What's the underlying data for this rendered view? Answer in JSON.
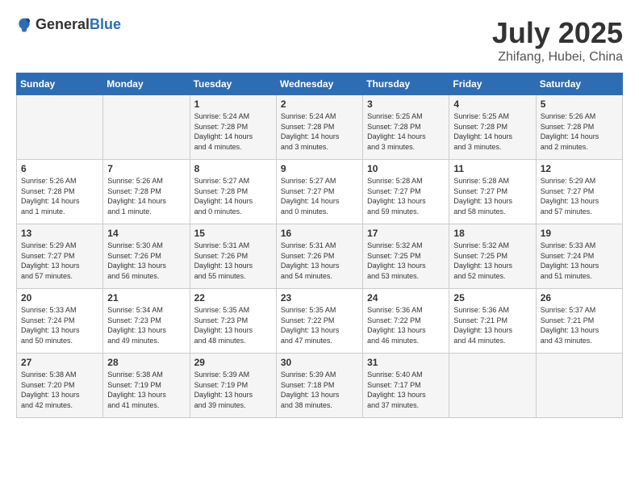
{
  "header": {
    "logo_general": "General",
    "logo_blue": "Blue",
    "month_year": "July 2025",
    "location": "Zhifang, Hubei, China"
  },
  "weekdays": [
    "Sunday",
    "Monday",
    "Tuesday",
    "Wednesday",
    "Thursday",
    "Friday",
    "Saturday"
  ],
  "weeks": [
    [
      {
        "day": "",
        "info": ""
      },
      {
        "day": "",
        "info": ""
      },
      {
        "day": "1",
        "info": "Sunrise: 5:24 AM\nSunset: 7:28 PM\nDaylight: 14 hours\nand 4 minutes."
      },
      {
        "day": "2",
        "info": "Sunrise: 5:24 AM\nSunset: 7:28 PM\nDaylight: 14 hours\nand 3 minutes."
      },
      {
        "day": "3",
        "info": "Sunrise: 5:25 AM\nSunset: 7:28 PM\nDaylight: 14 hours\nand 3 minutes."
      },
      {
        "day": "4",
        "info": "Sunrise: 5:25 AM\nSunset: 7:28 PM\nDaylight: 14 hours\nand 3 minutes."
      },
      {
        "day": "5",
        "info": "Sunrise: 5:26 AM\nSunset: 7:28 PM\nDaylight: 14 hours\nand 2 minutes."
      }
    ],
    [
      {
        "day": "6",
        "info": "Sunrise: 5:26 AM\nSunset: 7:28 PM\nDaylight: 14 hours\nand 1 minute."
      },
      {
        "day": "7",
        "info": "Sunrise: 5:26 AM\nSunset: 7:28 PM\nDaylight: 14 hours\nand 1 minute."
      },
      {
        "day": "8",
        "info": "Sunrise: 5:27 AM\nSunset: 7:28 PM\nDaylight: 14 hours\nand 0 minutes."
      },
      {
        "day": "9",
        "info": "Sunrise: 5:27 AM\nSunset: 7:27 PM\nDaylight: 14 hours\nand 0 minutes."
      },
      {
        "day": "10",
        "info": "Sunrise: 5:28 AM\nSunset: 7:27 PM\nDaylight: 13 hours\nand 59 minutes."
      },
      {
        "day": "11",
        "info": "Sunrise: 5:28 AM\nSunset: 7:27 PM\nDaylight: 13 hours\nand 58 minutes."
      },
      {
        "day": "12",
        "info": "Sunrise: 5:29 AM\nSunset: 7:27 PM\nDaylight: 13 hours\nand 57 minutes."
      }
    ],
    [
      {
        "day": "13",
        "info": "Sunrise: 5:29 AM\nSunset: 7:27 PM\nDaylight: 13 hours\nand 57 minutes."
      },
      {
        "day": "14",
        "info": "Sunrise: 5:30 AM\nSunset: 7:26 PM\nDaylight: 13 hours\nand 56 minutes."
      },
      {
        "day": "15",
        "info": "Sunrise: 5:31 AM\nSunset: 7:26 PM\nDaylight: 13 hours\nand 55 minutes."
      },
      {
        "day": "16",
        "info": "Sunrise: 5:31 AM\nSunset: 7:26 PM\nDaylight: 13 hours\nand 54 minutes."
      },
      {
        "day": "17",
        "info": "Sunrise: 5:32 AM\nSunset: 7:25 PM\nDaylight: 13 hours\nand 53 minutes."
      },
      {
        "day": "18",
        "info": "Sunrise: 5:32 AM\nSunset: 7:25 PM\nDaylight: 13 hours\nand 52 minutes."
      },
      {
        "day": "19",
        "info": "Sunrise: 5:33 AM\nSunset: 7:24 PM\nDaylight: 13 hours\nand 51 minutes."
      }
    ],
    [
      {
        "day": "20",
        "info": "Sunrise: 5:33 AM\nSunset: 7:24 PM\nDaylight: 13 hours\nand 50 minutes."
      },
      {
        "day": "21",
        "info": "Sunrise: 5:34 AM\nSunset: 7:23 PM\nDaylight: 13 hours\nand 49 minutes."
      },
      {
        "day": "22",
        "info": "Sunrise: 5:35 AM\nSunset: 7:23 PM\nDaylight: 13 hours\nand 48 minutes."
      },
      {
        "day": "23",
        "info": "Sunrise: 5:35 AM\nSunset: 7:22 PM\nDaylight: 13 hours\nand 47 minutes."
      },
      {
        "day": "24",
        "info": "Sunrise: 5:36 AM\nSunset: 7:22 PM\nDaylight: 13 hours\nand 46 minutes."
      },
      {
        "day": "25",
        "info": "Sunrise: 5:36 AM\nSunset: 7:21 PM\nDaylight: 13 hours\nand 44 minutes."
      },
      {
        "day": "26",
        "info": "Sunrise: 5:37 AM\nSunset: 7:21 PM\nDaylight: 13 hours\nand 43 minutes."
      }
    ],
    [
      {
        "day": "27",
        "info": "Sunrise: 5:38 AM\nSunset: 7:20 PM\nDaylight: 13 hours\nand 42 minutes."
      },
      {
        "day": "28",
        "info": "Sunrise: 5:38 AM\nSunset: 7:19 PM\nDaylight: 13 hours\nand 41 minutes."
      },
      {
        "day": "29",
        "info": "Sunrise: 5:39 AM\nSunset: 7:19 PM\nDaylight: 13 hours\nand 39 minutes."
      },
      {
        "day": "30",
        "info": "Sunrise: 5:39 AM\nSunset: 7:18 PM\nDaylight: 13 hours\nand 38 minutes."
      },
      {
        "day": "31",
        "info": "Sunrise: 5:40 AM\nSunset: 7:17 PM\nDaylight: 13 hours\nand 37 minutes."
      },
      {
        "day": "",
        "info": ""
      },
      {
        "day": "",
        "info": ""
      }
    ]
  ]
}
